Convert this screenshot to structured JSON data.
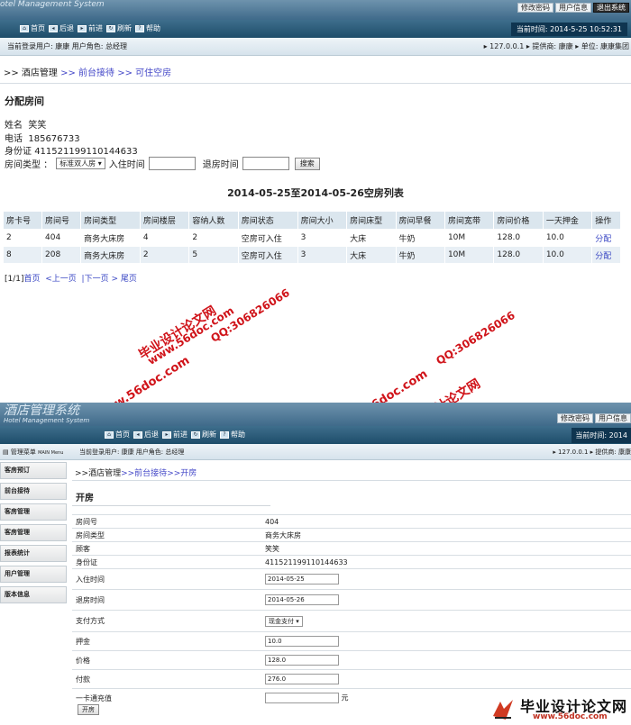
{
  "top": {
    "logo_text": "otel Management System",
    "top_links": [
      "修改密码",
      "用户信息",
      "退出系统"
    ],
    "nav": [
      "首页",
      "后退",
      "前进",
      "刷新",
      "帮助"
    ],
    "time": "当前时间: 2014-5-25 10:52:31",
    "userbar_left": "当前登录用户: 康康  用户角色: 总经理",
    "userbar_right": "▸ 127.0.0.1  ▸ 提供商: 康康  ▸ 单位: 康康集团",
    "breadcrumb": {
      "p0": ">> 酒店管理 ",
      "p1": ">> 前台接待 ",
      "p2": ">> 可住空房"
    },
    "section_title": "分配房间",
    "guest": {
      "name_label": "姓名",
      "name": "笑笑",
      "phone_label": "电话",
      "phone": "185676733",
      "id_label": "身份证",
      "id": "411521199110144633"
    },
    "filter": {
      "room_type_label": "房间类型 ：",
      "room_type_value": "标准双人房 ▾",
      "checkin_label": "入住时间",
      "checkout_label": "退房时间",
      "search_button": "搜索"
    },
    "list_title": "2014-05-25至2014-05-26空房列表",
    "table": {
      "headers": [
        "房卡号",
        "房间号",
        "房间类型",
        "房间楼层",
        "容纳人数",
        "房间状态",
        "房间大小",
        "房间床型",
        "房间早餐",
        "房间宽带",
        "房间价格",
        "一天押金",
        "操作"
      ],
      "rows": [
        [
          "2",
          "404",
          "商务大床房",
          "4",
          "2",
          "空房可入住",
          "3",
          "大床",
          "牛奶",
          "10M",
          "128.0",
          "10.0",
          "分配"
        ],
        [
          "8",
          "208",
          "商务大床房",
          "2",
          "5",
          "空房可入住",
          "3",
          "大床",
          "牛奶",
          "10M",
          "128.0",
          "10.0",
          "分配"
        ]
      ]
    },
    "pager": {
      "count": "[1/1]",
      "first": "首页",
      "prev": "<上一页",
      "next": "|下一页",
      "last": "> 尾页"
    }
  },
  "watermarks": {
    "w1": "毕业设计论文网",
    "w2": "www.56doc.com",
    "w3": "QQ:306826066"
  },
  "bottom": {
    "logo_title": "酒店管理系统",
    "logo_sub": "Hotel Management System",
    "top_links": [
      "修改密码",
      "用户信息"
    ],
    "nav": [
      "首页",
      "后退",
      "前进",
      "刷新",
      "帮助"
    ],
    "time": "当前时间: 2014",
    "menu_label": "管理菜单",
    "menu_label_en": "MAIN Menu",
    "userbar_mid": "当前登录用户: 康康  用户角色: 总经理",
    "userbar_right": "▸ 127.0.0.1  ▸ 提供商: 康康",
    "sidebar": [
      "客房预订",
      "前台接待",
      "客房管理",
      "客房管理",
      "报表统计",
      "用户管理",
      "版本信息"
    ],
    "breadcrumb": {
      "p0": ">>酒店管理",
      "p1": ">>前台接待",
      "p2": ">>开房"
    },
    "section_title": "开房",
    "fields": {
      "room_no_label": "房间号",
      "room_no": "404",
      "room_type_label": "房间类型",
      "room_type": "商务大床房",
      "guest_label": "顾客",
      "guest": "笑笑",
      "id_label": "身份证",
      "id": "411521199110144633",
      "checkin_label": "入住时间",
      "checkin": "2014-05-25",
      "checkout_label": "退房时间",
      "checkout": "2014-05-26",
      "pay_label": "支付方式",
      "pay": "现金支付 ▾",
      "deposit_label": "押金",
      "deposit": "10.0",
      "price_label": "价格",
      "price": "128.0",
      "paid_label": "付款",
      "paid": "276.0",
      "card_label": "一卡通充值",
      "card_unit": "元"
    },
    "submit_button": "开房",
    "footer_logo": "毕业设计论文网",
    "footer_url": "www.56doc.com"
  }
}
